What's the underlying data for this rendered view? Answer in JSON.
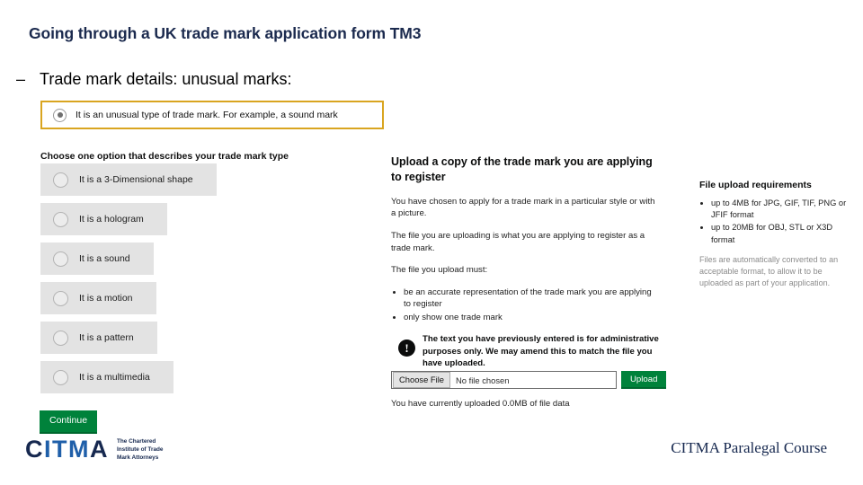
{
  "slide": {
    "title": "Going through a UK trade mark application form TM3",
    "bullet_dash": "–",
    "bullet_text": "Trade mark details: unusual marks:"
  },
  "form": {
    "selected_option": {
      "label": "It is an unusual type of trade mark. For example, a sound mark",
      "radio_state": "selected",
      "highlight_color": "#d9a520"
    },
    "choose_heading": "Choose one option that describes your trade mark type",
    "options": [
      {
        "label": "It is a 3-Dimensional shape"
      },
      {
        "label": "It is a hologram"
      },
      {
        "label": "It is a sound"
      },
      {
        "label": "It is a motion"
      },
      {
        "label": "It is a pattern"
      },
      {
        "label": "It is a multimedia"
      }
    ],
    "continue_label": "Continue",
    "continue_color": "#00823b"
  },
  "upload_panel": {
    "heading": "Upload a copy of the trade mark you are applying to register",
    "paragraphs": [
      "You have chosen to apply for a trade mark in a particular style or with a picture.",
      "The file you are uploading is what you are applying to register as a trade mark.",
      "The file you upload must:"
    ],
    "must_bullets": [
      "be an accurate representation of the trade mark you are applying to register",
      "only show one trade mark"
    ],
    "warning": {
      "icon": "!",
      "text": "The text you have previously entered is for administrative purposes only. We may amend this to match the file you have uploaded."
    },
    "file_field": {
      "button_label": "Choose File",
      "value": "No file chosen"
    },
    "upload_button": "Upload",
    "uploaded_note": "You have currently uploaded 0.0MB of file data"
  },
  "requirements_panel": {
    "heading": "File upload requirements",
    "bullets": [
      "up to 4MB for JPG, GIF, TIF, PNG or JFIF format",
      "up to 20MB for OBJ, STL or X3D format"
    ],
    "note": "Files are automatically converted to an acceptable format, to allow it to be uploaded as part of your application."
  },
  "footer": {
    "logo": {
      "part1": "C",
      "part2": "ITM",
      "part3": "A",
      "tagline_line1": "The Chartered",
      "tagline_line2": "Institute of Trade",
      "tagline_line3": "Mark Attorneys"
    },
    "course": "CITMA Paralegal Course"
  }
}
